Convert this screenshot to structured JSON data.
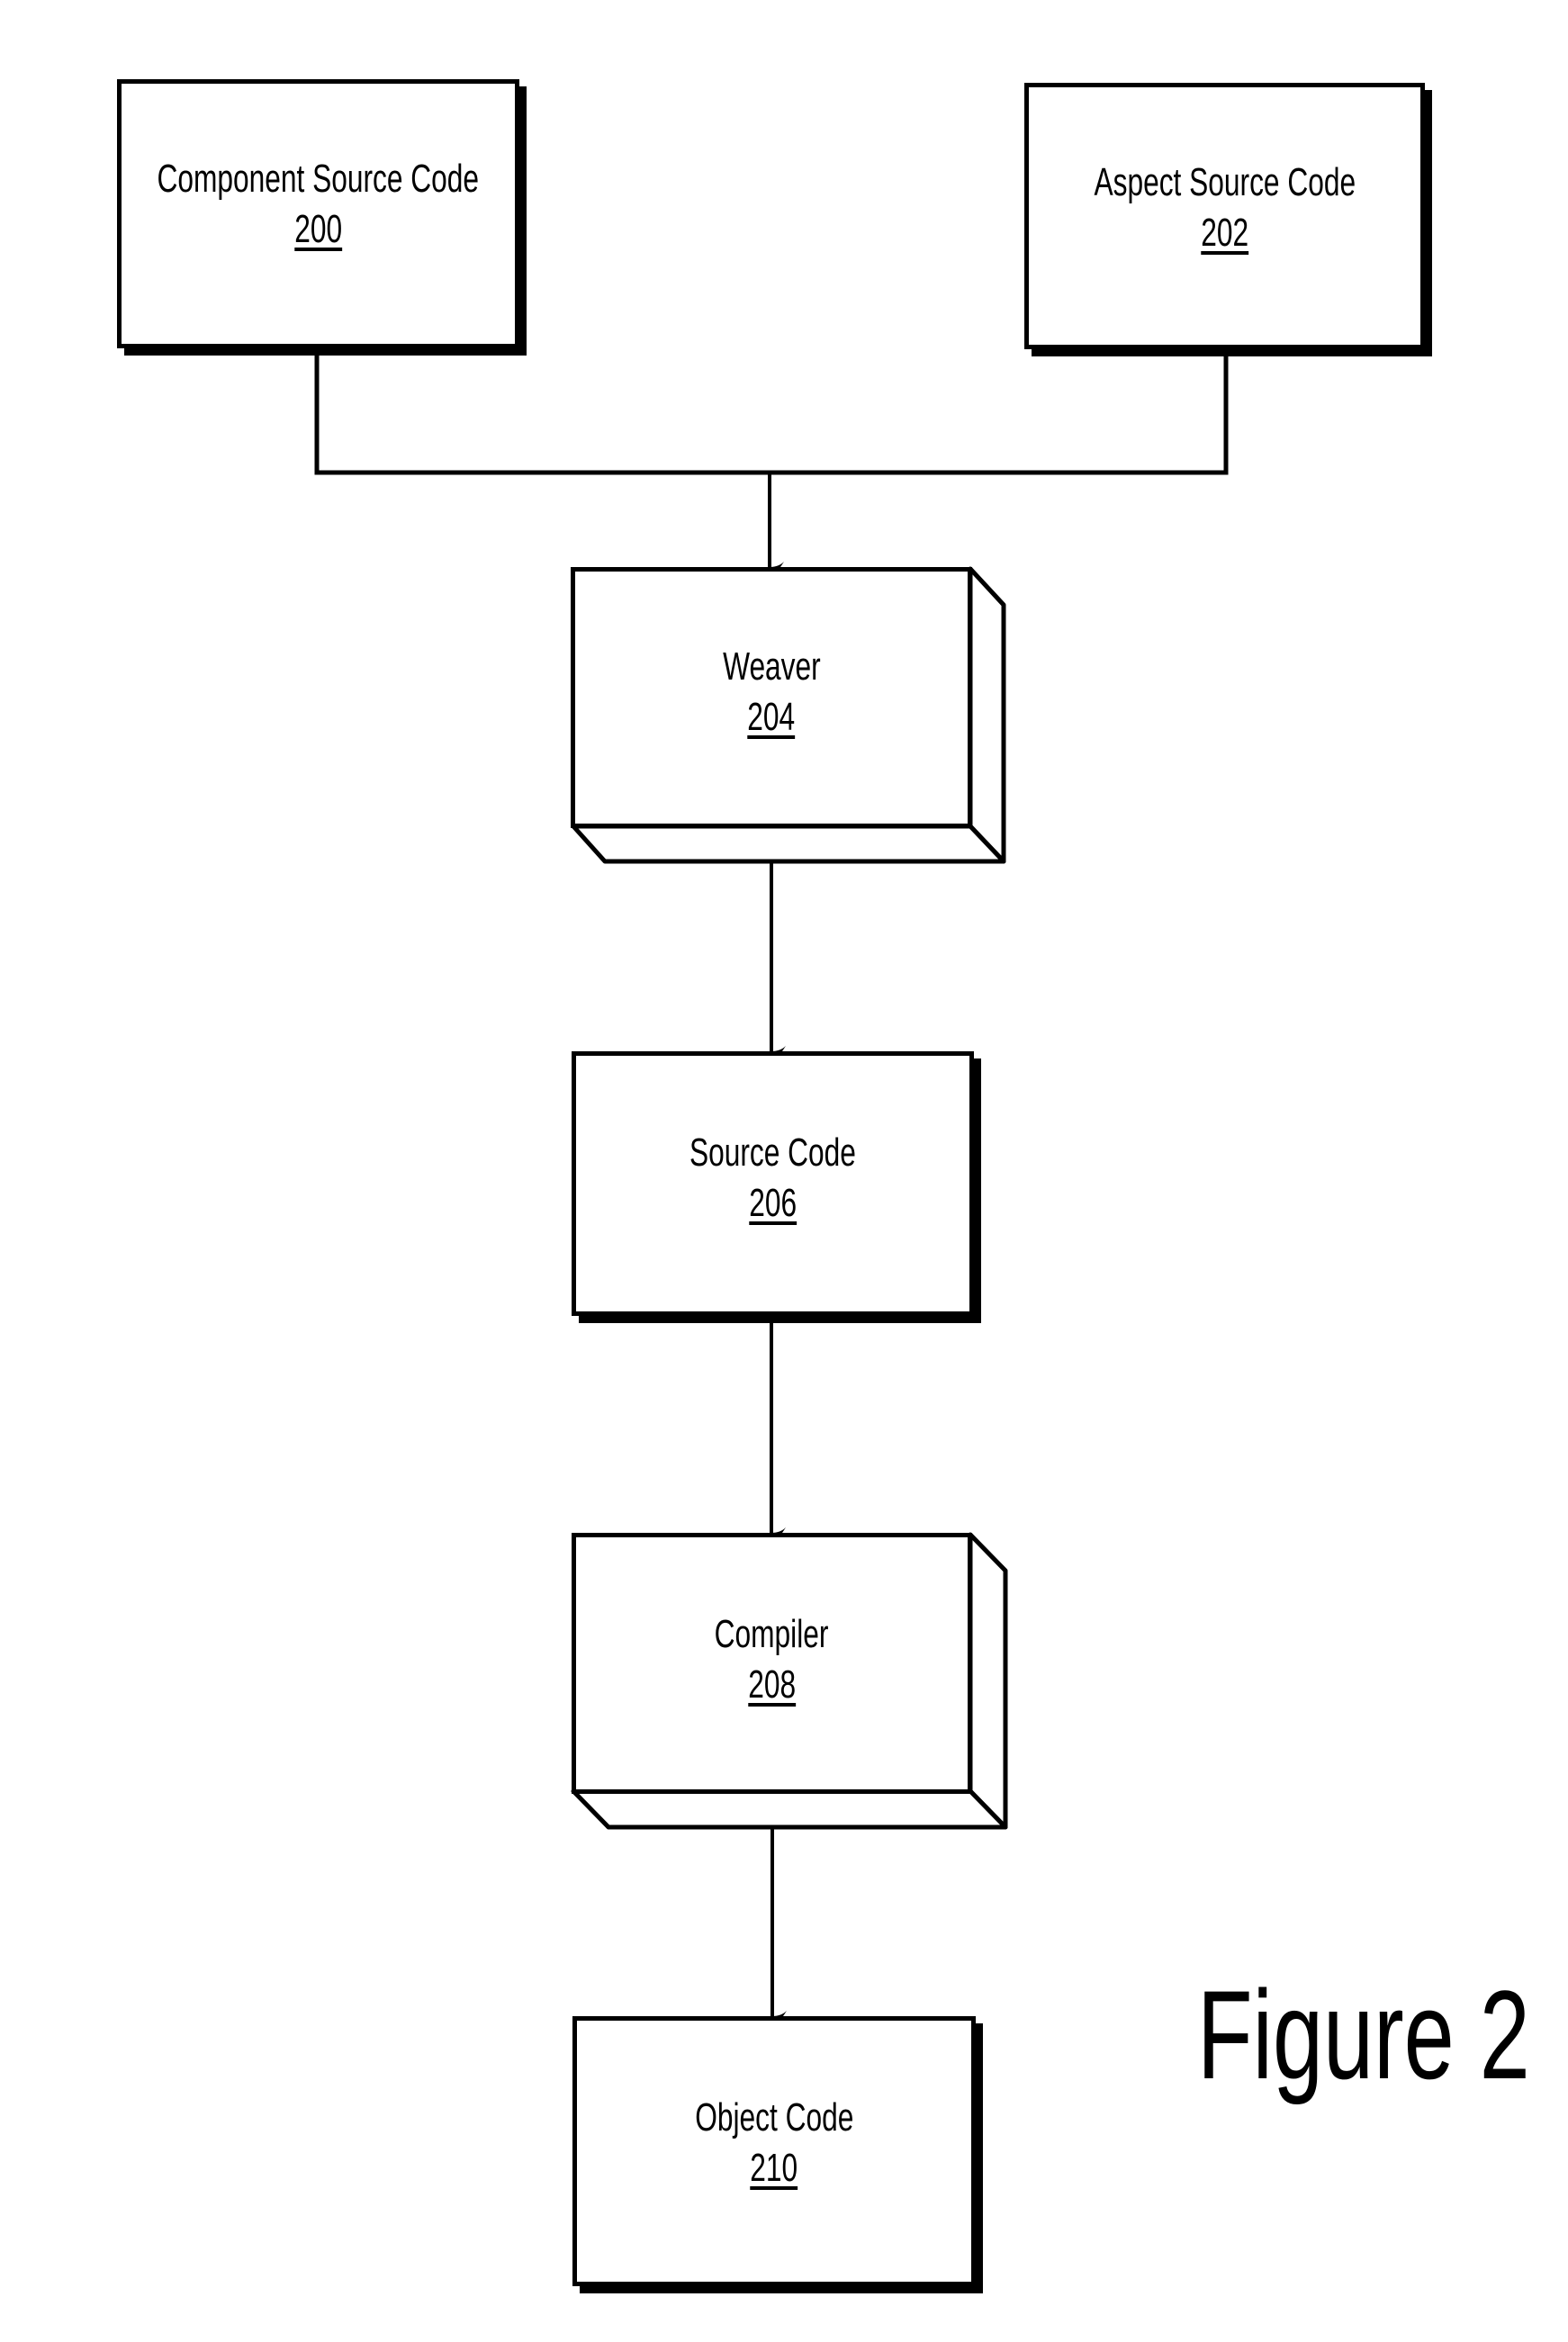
{
  "figure_label": "Figure 2",
  "nodes": [
    {
      "id": "component-source-code",
      "label": "Component Source Code",
      "ref": "200",
      "style": "box"
    },
    {
      "id": "aspect-source-code",
      "label": "Aspect Source Code",
      "ref": "202",
      "style": "box"
    },
    {
      "id": "weaver",
      "label": "Weaver",
      "ref": "204",
      "style": "3d-block"
    },
    {
      "id": "source-code",
      "label": "Source Code",
      "ref": "206",
      "style": "box"
    },
    {
      "id": "compiler",
      "label": "Compiler",
      "ref": "208",
      "style": "3d-block"
    },
    {
      "id": "object-code",
      "label": "Object Code",
      "ref": "210",
      "style": "box"
    }
  ],
  "edges": [
    {
      "from": "component-source-code",
      "to": "weaver",
      "merged": true
    },
    {
      "from": "aspect-source-code",
      "to": "weaver",
      "merged": true
    },
    {
      "from": "weaver",
      "to": "source-code"
    },
    {
      "from": "source-code",
      "to": "compiler"
    },
    {
      "from": "compiler",
      "to": "object-code"
    }
  ]
}
